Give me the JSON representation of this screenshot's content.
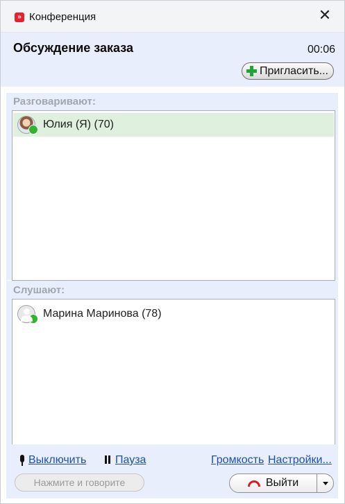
{
  "window": {
    "title": "Конференция",
    "app_icon_glyph": "»",
    "close_glyph": "✕"
  },
  "header": {
    "conference_name": "Обсуждение заказа",
    "timer": "00:06",
    "invite_label": "Пригласить..."
  },
  "speakers": {
    "label": "Разговаривают:",
    "participants": [
      {
        "name": "Юлия (Я) (70)",
        "avatar": "photo-avatar",
        "status": "online",
        "selected": true
      }
    ]
  },
  "listeners": {
    "label": "Слушают:",
    "participants": [
      {
        "name": "Марина Маринова (78)",
        "avatar": "generic-user-avatar",
        "status": "online",
        "selected": false
      }
    ]
  },
  "footer": {
    "mute_label": "Выключить",
    "pause_label": "Пауза",
    "volume_label": "Громкость",
    "settings_label": "Настройки...",
    "push_to_talk_label": "Нажмите и говорите",
    "exit_label": "Выйти"
  },
  "colors": {
    "accent_panel": "#e8eefb",
    "status_online": "#2fb52f",
    "selected_row": "#dff0df",
    "link": "#1f4fb3",
    "hangup": "#e0191f"
  }
}
